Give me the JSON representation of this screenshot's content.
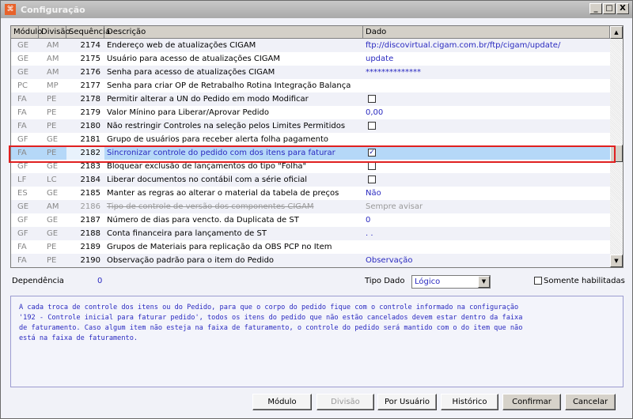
{
  "window": {
    "title": "Configuração",
    "minimize": "_",
    "maximize": "□",
    "close": "X"
  },
  "grid": {
    "headers": [
      "Módulo",
      "Divisão",
      "Sequência",
      "Descrição",
      "Dado"
    ],
    "rows": [
      {
        "mod": "GE",
        "div": "AM",
        "seq": "2174",
        "desc": "Endereço web de atualizações CIGAM",
        "dado": "ftp://discovirtual.cigam.com.br/ftp/cigam/update/"
      },
      {
        "mod": "GE",
        "div": "AM",
        "seq": "2175",
        "desc": "Usuário para acesso de atualizações CIGAM",
        "dado": "update"
      },
      {
        "mod": "GE",
        "div": "AM",
        "seq": "2176",
        "desc": "Senha para acesso de atualizações CIGAM",
        "dado": "**************"
      },
      {
        "mod": "PC",
        "div": "MP",
        "seq": "2177",
        "desc": "Senha para criar OP de Retrabalho Rotina Integração Balança",
        "dado": ""
      },
      {
        "mod": "FA",
        "div": "PE",
        "seq": "2178",
        "desc": "Permitir alterar a UN do Pedido em modo Modificar",
        "checkbox": false
      },
      {
        "mod": "FA",
        "div": "PE",
        "seq": "2179",
        "desc": "Valor Mínino para Liberar/Aprovar Pedido",
        "dado": "0,00"
      },
      {
        "mod": "FA",
        "div": "PE",
        "seq": "2180",
        "desc": "Não restringir Controles na seleção pelos Limites Permitidos",
        "checkbox": false
      },
      {
        "mod": "GF",
        "div": "GE",
        "seq": "2181",
        "desc": "Grupo de usuários para receber alerta folha pagamento",
        "dado": ""
      },
      {
        "mod": "FA",
        "div": "PE",
        "seq": "2182",
        "desc": "Sincronizar controle do pedido com dos itens para faturar",
        "checkbox": true,
        "selected": true
      },
      {
        "mod": "GF",
        "div": "GE",
        "seq": "2183",
        "desc": "Bloquear exclusão de lançamentos do tipo \"Folha\"",
        "checkbox": false
      },
      {
        "mod": "LF",
        "div": "LC",
        "seq": "2184",
        "desc": "Liberar documentos no contábil com a série oficial",
        "checkbox": false
      },
      {
        "mod": "ES",
        "div": "GE",
        "seq": "2185",
        "desc": "Manter as regras ao alterar o material da tabela de preços",
        "dado": "Não"
      },
      {
        "mod": "GE",
        "div": "AM",
        "seq": "2186",
        "desc": "Tipo de controle de versão dos componentes CIGAM",
        "dado": "Sempre avisar",
        "disabled": true
      },
      {
        "mod": "GF",
        "div": "GE",
        "seq": "2187",
        "desc": "Número de dias para vencto. da Duplicata de ST",
        "dado": "0"
      },
      {
        "mod": "GF",
        "div": "GE",
        "seq": "2188",
        "desc": "Conta financeira para lançamento de ST",
        "dado": " . ."
      },
      {
        "mod": "FA",
        "div": "PE",
        "seq": "2189",
        "desc": "Grupos de Materiais para replicação da OBS PCP no Item",
        "dado": ""
      },
      {
        "mod": "FA",
        "div": "PE",
        "seq": "2190",
        "desc": "Observação padrão para o item do Pedido",
        "dado": "Observação"
      }
    ]
  },
  "footer": {
    "dependencia_label": "Dependência",
    "dependencia_value": "0",
    "tipo_dado_label": "Tipo Dado",
    "tipo_dado_value": "Lógico",
    "somente_label": "Somente habilitadas"
  },
  "memo": "A cada troca de controle dos itens ou do Pedido, para que o corpo do pedido fique com o controle informado na configuração\n'192 - Controle inicial para faturar pedido', todos os itens do pedido que não estão cancelados devem estar dentro da faixa\nde faturamento. Caso algum item não esteja na faixa de faturamento, o controle do pedido será mantido com o do item que não\nestá na faixa de faturamento.",
  "buttons": {
    "modulo": "Módulo",
    "divisao": "Divisão",
    "por_usuario": "Por Usuário",
    "historico": "Histórico",
    "confirmar": "Confirmar",
    "cancelar": "Cancelar"
  }
}
